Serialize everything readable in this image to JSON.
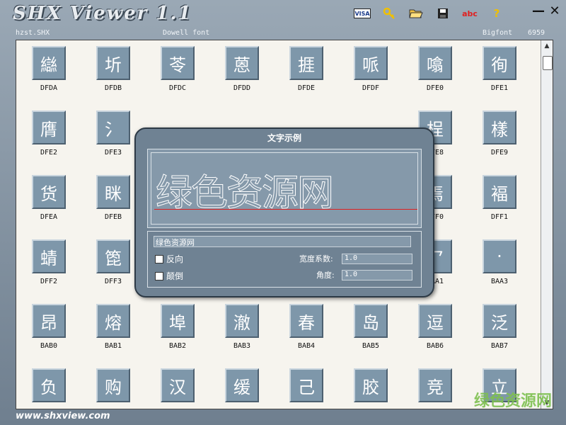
{
  "app": {
    "title": "SHX Viewer 1.1",
    "toolbar": {
      "visa_label": "VISA",
      "key_icon": "key-icon",
      "open_icon": "folder-open-icon",
      "save_icon": "floppy-icon",
      "abc_label": "abc",
      "help_label": "?"
    },
    "window": {
      "minimize": "—",
      "close": "✕"
    }
  },
  "info": {
    "file": "hzst.SHX",
    "font_type": "Dowell font",
    "bigfont": "Bigfont",
    "count": "6959"
  },
  "rows": [
    [
      {
        "glyph": "䜌",
        "code": "DFDA"
      },
      {
        "glyph": "圻",
        "code": "DFDB"
      },
      {
        "glyph": "苓",
        "code": "DFDC"
      },
      {
        "glyph": "蒽",
        "code": "DFDD"
      },
      {
        "glyph": "捱",
        "code": "DFDE"
      },
      {
        "glyph": "哌",
        "code": "DFDF"
      },
      {
        "glyph": "噏",
        "code": "DFE0"
      },
      {
        "glyph": "徇",
        "code": "DFE1"
      }
    ],
    [
      {
        "glyph": "膺",
        "code": "DFE2"
      },
      {
        "glyph": "氵",
        "code": "DFE3"
      },
      {
        "glyph": "",
        "code": ""
      },
      {
        "glyph": "",
        "code": ""
      },
      {
        "glyph": "",
        "code": ""
      },
      {
        "glyph": "",
        "code": ""
      },
      {
        "glyph": "桯",
        "code": "DFE8"
      },
      {
        "glyph": "樣",
        "code": "DFE9"
      }
    ],
    [
      {
        "glyph": "货",
        "code": "DFEA"
      },
      {
        "glyph": "眯",
        "code": "DFEB"
      },
      {
        "glyph": "",
        "code": ""
      },
      {
        "glyph": "",
        "code": ""
      },
      {
        "glyph": "",
        "code": ""
      },
      {
        "glyph": "",
        "code": ""
      },
      {
        "glyph": "焉",
        "code": "DFF0"
      },
      {
        "glyph": "褔",
        "code": "DFF1"
      }
    ],
    [
      {
        "glyph": "蜻",
        "code": "DFF2"
      },
      {
        "glyph": "箆",
        "code": "DFF3"
      },
      {
        "glyph": "",
        "code": ""
      },
      {
        "glyph": "",
        "code": ""
      },
      {
        "glyph": "",
        "code": ""
      },
      {
        "glyph": "",
        "code": ""
      },
      {
        "glyph": "乛",
        "code": "BAA1"
      },
      {
        "glyph": "·",
        "code": "BAA3"
      }
    ],
    [
      {
        "glyph": "昂",
        "code": "BAB0"
      },
      {
        "glyph": "熔",
        "code": "BAB1"
      },
      {
        "glyph": "埠",
        "code": "BAB2"
      },
      {
        "glyph": "澈",
        "code": "BAB3"
      },
      {
        "glyph": "春",
        "code": "BAB4"
      },
      {
        "glyph": "岛",
        "code": "BAB5"
      },
      {
        "glyph": "逗",
        "code": "BAB6"
      },
      {
        "glyph": "泛",
        "code": "BAB7"
      }
    ],
    [
      {
        "glyph": "负",
        "code": ""
      },
      {
        "glyph": "购",
        "code": ""
      },
      {
        "glyph": "汉",
        "code": ""
      },
      {
        "glyph": "缓",
        "code": ""
      },
      {
        "glyph": "己",
        "code": ""
      },
      {
        "glyph": "胶",
        "code": ""
      },
      {
        "glyph": "竞",
        "code": ""
      },
      {
        "glyph": "立",
        "code": ""
      }
    ]
  ],
  "footer": {
    "url": "www.shxview.com",
    "watermark": "绿色资源网"
  },
  "dialog": {
    "title": "文字示例",
    "preview_text": "绿色资源网",
    "input_value": "绿色资源网",
    "reverse_label": "反向",
    "upside_down_label": "颠倒",
    "width_label": "宽度系数:",
    "width_value": "1.0",
    "angle_label": "角度:",
    "angle_value": "1.0"
  }
}
